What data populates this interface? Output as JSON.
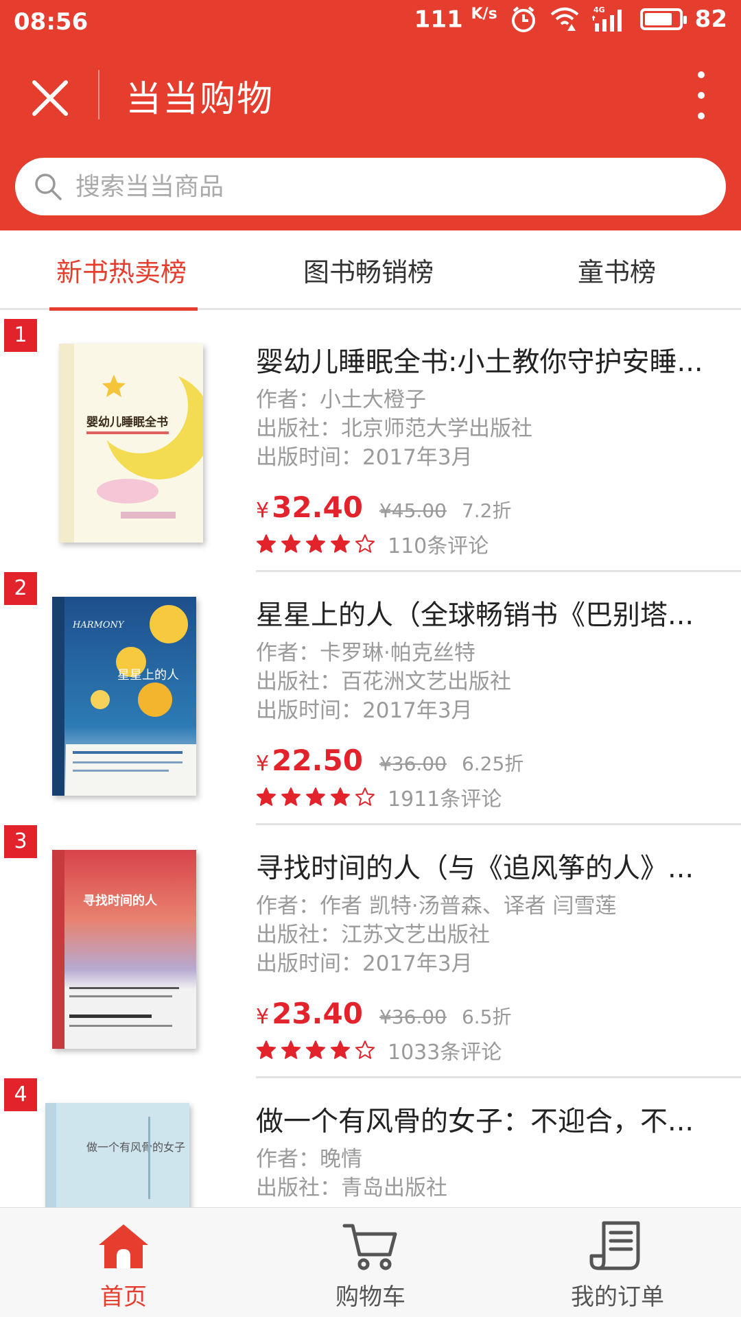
{
  "status_bar": {
    "time": "08:56",
    "speed": "111",
    "speed_unit": "K/s",
    "battery": "82",
    "network": "4G"
  },
  "header": {
    "title": "当当购物"
  },
  "search": {
    "placeholder": "搜索当当商品"
  },
  "tabs": [
    {
      "label": "新书热卖榜",
      "active": true
    },
    {
      "label": "图书畅销榜",
      "active": false
    },
    {
      "label": "童书榜",
      "active": false
    }
  ],
  "books": [
    {
      "rank": "1",
      "title": "婴幼儿睡眠全书:小土教你守护安睡...",
      "author": "作者：小土大橙子",
      "publisher": "出版社：北京师范大学出版社",
      "pub_date": "出版时间：2017年3月",
      "currency": "¥",
      "price": "32.40",
      "original_price": "¥45.00",
      "discount": "7.2折",
      "stars": 4,
      "reviews": "110条评论",
      "cover_text": "婴幼儿睡眠全书"
    },
    {
      "rank": "2",
      "title": "星星上的人（全球畅销书《巴别塔...",
      "author": "作者：卡罗琳·帕克丝特",
      "publisher": "出版社：百花洲文艺出版社",
      "pub_date": "出版时间：2017年3月",
      "currency": "¥",
      "price": "22.50",
      "original_price": "¥36.00",
      "discount": "6.25折",
      "stars": 4,
      "reviews": "1911条评论",
      "cover_text": "星星上的人",
      "cover_sub": "HARMONY"
    },
    {
      "rank": "3",
      "title": "寻找时间的人（与《追风筝的人》...",
      "author": "作者：作者 凯特·汤普森、译者 闫雪莲",
      "publisher": "出版社：江苏文艺出版社",
      "pub_date": "出版时间：2017年3月",
      "currency": "¥",
      "price": "23.40",
      "original_price": "¥36.00",
      "discount": "6.5折",
      "stars": 4,
      "reviews": "1033条评论",
      "cover_text": "寻找时间的人"
    },
    {
      "rank": "4",
      "title": "做一个有风骨的女子：不迎合，不...",
      "author": "作者：晚情",
      "publisher": "出版社：青岛出版社",
      "cover_text": "做一个有风骨的女子"
    }
  ],
  "bottom_nav": [
    {
      "label": "首页",
      "icon": "home-icon",
      "active": true
    },
    {
      "label": "购物车",
      "icon": "cart-icon",
      "active": false
    },
    {
      "label": "我的订单",
      "icon": "orders-icon",
      "active": false
    }
  ],
  "colors": {
    "brand": "#e53e2f",
    "price": "#e3232b",
    "star": "#e3232b"
  }
}
